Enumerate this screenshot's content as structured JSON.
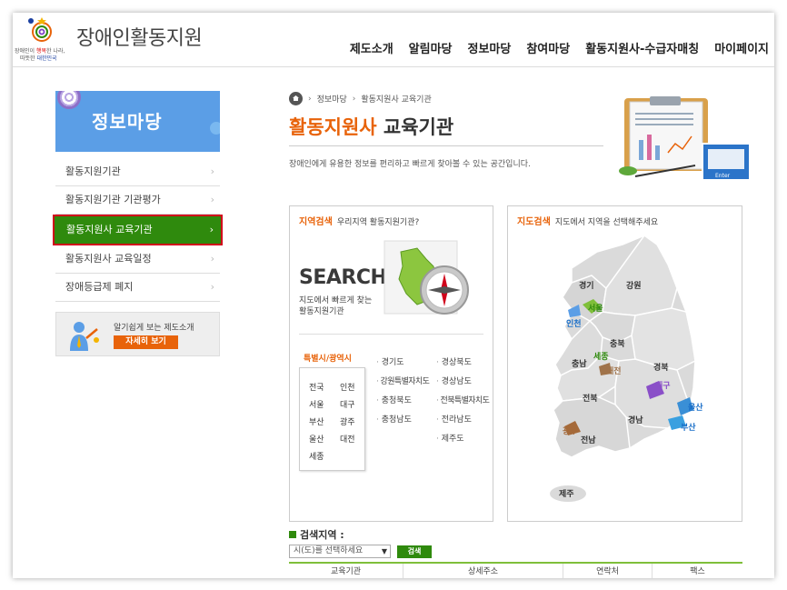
{
  "header": {
    "site_title": "장애인활동지원",
    "logo_tag_line1_a": "장애인이 ",
    "logo_tag_line1_b": "행복",
    "logo_tag_line1_c": "한 나라,",
    "logo_tag_line2_a": "따뜻한 ",
    "logo_tag_line2_b": "대한민국",
    "nav": [
      "제도소개",
      "알림마당",
      "정보마당",
      "참여마당",
      "활동지원사-수급자매칭",
      "마이페이지"
    ]
  },
  "sidebar": {
    "banner_title": "정보마당",
    "items": [
      {
        "label": "활동지원기관",
        "arrow": "›"
      },
      {
        "label": "활동지원기관 기관평가",
        "arrow": "›"
      },
      {
        "label": "활동지원사 교육기관",
        "arrow": "›",
        "active": true
      },
      {
        "label": "활동지원사 교육일정",
        "arrow": "›"
      },
      {
        "label": "장애등급제 폐지",
        "arrow": "›"
      }
    ],
    "intro_text": "알기쉽게 보는 제도소개",
    "intro_button": "자세히 보기"
  },
  "breadcrumb": [
    "정보마당",
    "활동지원사 교육기관"
  ],
  "page": {
    "title_highlight": "활동지원사",
    "title_rest": " 교육기관",
    "description": "장애인에게 유용한 정보를 편리하고 빠르게 찾아볼 수 있는 공간입니다."
  },
  "region_search": {
    "head_label": "지역검색",
    "head_sub": "우리지역 활동지원기관?",
    "big_text": "SEARCH",
    "sub1": "지도에서 빠르게 찾는",
    "sub2": "활동지원기관",
    "metro_head": "특별시/광역시",
    "metro": [
      "전국",
      "인천",
      "서울",
      "대구",
      "부산",
      "광주",
      "울산",
      "대전",
      "세종"
    ],
    "provinces_col1": [
      "경기도",
      "강원특별자치도",
      "충청북도",
      "충청남도"
    ],
    "provinces_col2": [
      "경상북도",
      "경상남도",
      "전북특별자치도",
      "전라남도",
      "제주도"
    ]
  },
  "map_search": {
    "head_label": "지도검색",
    "head_sub": "지도에서 지역을 선택해주세요",
    "regions": {
      "gyeonggi": "경기",
      "seoul": "서울",
      "incheon": "인천",
      "gangwon": "강원",
      "chungbuk": "충북",
      "sejong": "세종",
      "chungnam": "충남",
      "daejeon": "대전",
      "gyeongbuk": "경북",
      "daegu": "대구",
      "jeonbuk": "전북",
      "gyeongnam": "경남",
      "ulsan": "울산",
      "busan": "부산",
      "gwangju": "광주",
      "jeonnam": "전남",
      "jeju": "제주"
    }
  },
  "results": {
    "label": "검색지역 :",
    "select_placeholder": "시(도)를 선택하세요",
    "search_button": "검색",
    "columns": [
      "교육기관",
      "상세주소",
      "연락처",
      "팩스"
    ]
  },
  "colors": {
    "accent_orange": "#e8630a",
    "active_green": "#2f8a0d",
    "highlight_red": "#d0021b",
    "banner_blue": "#5b9ee6"
  }
}
